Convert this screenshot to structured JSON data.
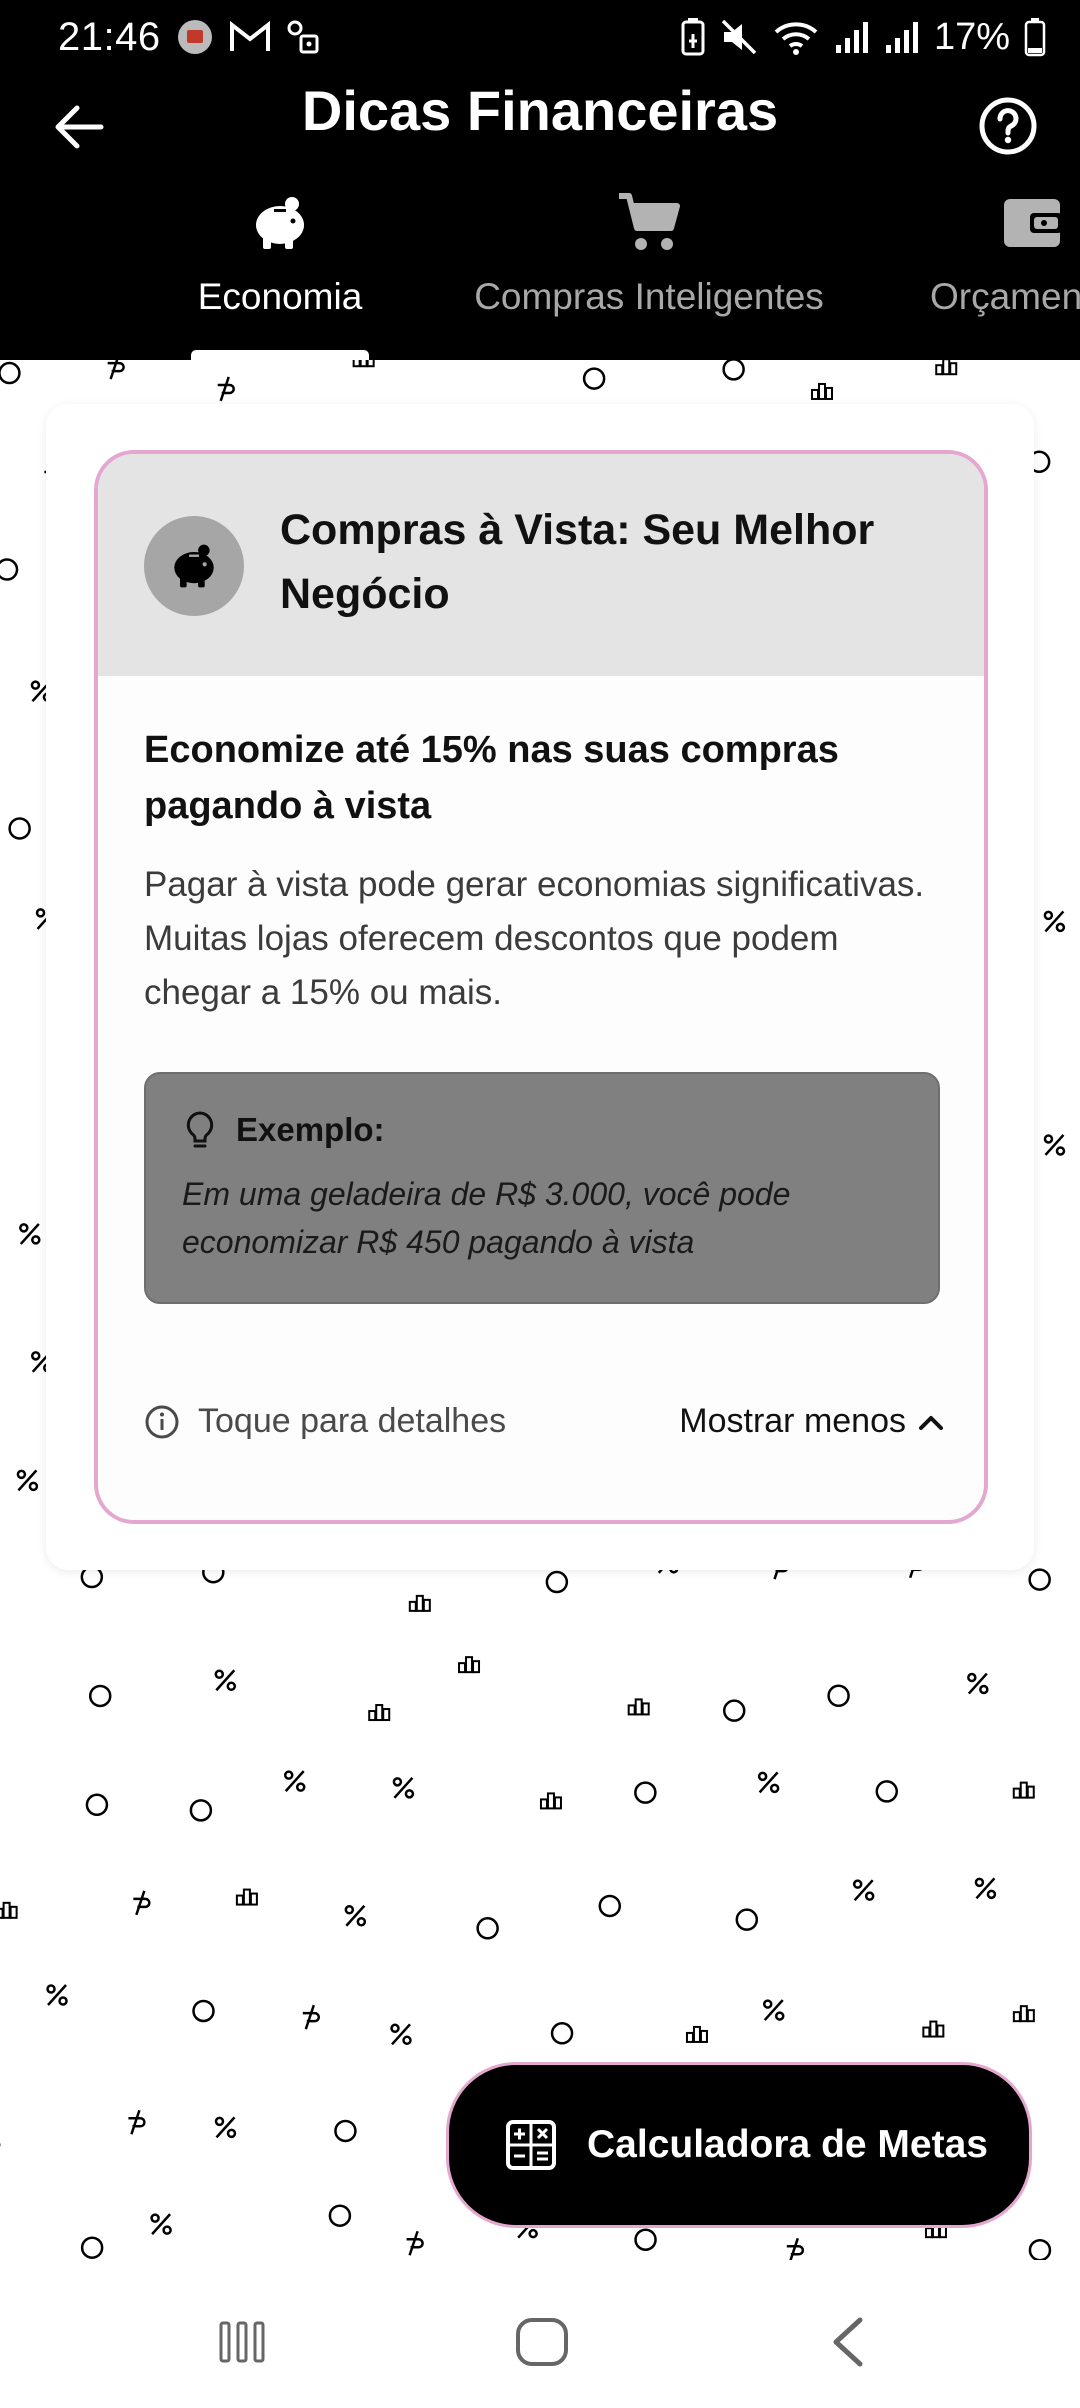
{
  "status_bar": {
    "time": "21:46",
    "battery": "17%",
    "left_icons": [
      "app-icon",
      "gmail-icon",
      "vpn-key-icon"
    ],
    "right_icons": [
      "battery-saver-icon",
      "mute-icon",
      "wifi-icon",
      "signal-icon",
      "signal-icon",
      "battery-icon"
    ]
  },
  "app_bar": {
    "title": "Dicas Financeiras",
    "back_icon": "arrow-left-icon",
    "help_icon": "help-circle-icon"
  },
  "tabs": [
    {
      "label": "Economia",
      "icon": "piggy-bank-icon",
      "active": true
    },
    {
      "label": "Compras Inteligentes",
      "icon": "cart-icon",
      "active": false
    },
    {
      "label": "Orçamento",
      "icon": "wallet-icon",
      "active": false
    }
  ],
  "card": {
    "title": "Compras à Vista: Seu Melhor Negócio",
    "subtitle": "Economize até 15% nas suas compras pagando à vista",
    "description": "Pagar à vista pode gerar economias significativas. Muitas lojas oferecem descontos que podem chegar a 15% ou mais.",
    "example_label": "Exemplo:",
    "example_text": "Em uma geladeira de R$ 3.000, você pode economizar R$ 450 pagando à vista",
    "details_hint": "Toque para detalhes",
    "toggle_label": "Mostrar menos",
    "border_color": "#e4a7cf"
  },
  "fab": {
    "label": "Calculadora de Metas",
    "icon": "calculator-icon"
  },
  "nav_bar": {
    "icons": [
      "recents-icon",
      "home-icon",
      "back-nav-icon"
    ]
  }
}
